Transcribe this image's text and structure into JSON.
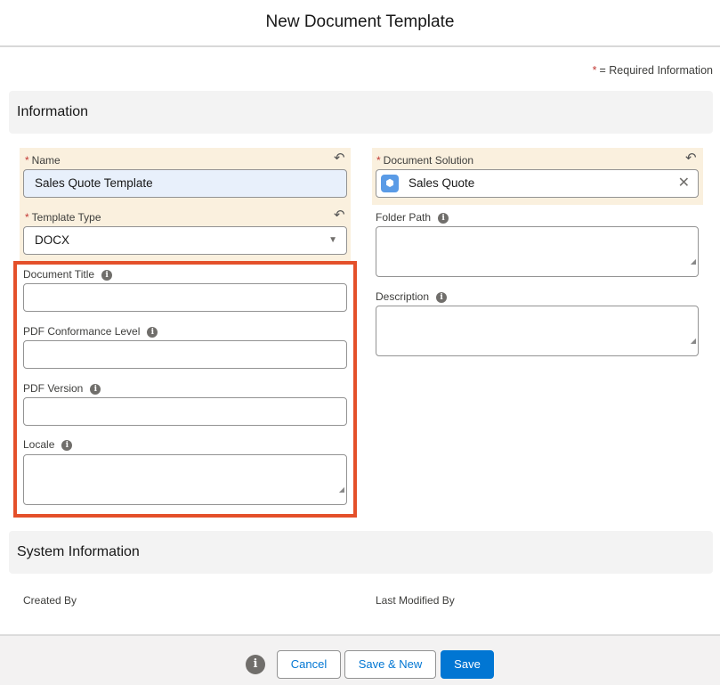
{
  "header": {
    "title": "New Document Template"
  },
  "required_note": {
    "star": "*",
    "text": "= Required Information"
  },
  "sections": {
    "information": "Information",
    "system": "System Information"
  },
  "fields": {
    "name": {
      "label": "Name",
      "value": "Sales Quote Template"
    },
    "template_type": {
      "label": "Template Type",
      "value": "DOCX"
    },
    "document_title": {
      "label": "Document Title",
      "value": ""
    },
    "pdf_conformance": {
      "label": "PDF Conformance Level",
      "value": ""
    },
    "pdf_version": {
      "label": "PDF Version",
      "value": ""
    },
    "locale": {
      "label": "Locale",
      "value": ""
    },
    "document_solution": {
      "label": "Document Solution",
      "value": "Sales Quote"
    },
    "folder_path": {
      "label": "Folder Path",
      "value": ""
    },
    "description": {
      "label": "Description",
      "value": ""
    }
  },
  "system": {
    "created_by": "Created By",
    "last_modified_by": "Last Modified By"
  },
  "footer": {
    "cancel": "Cancel",
    "save_new": "Save & New",
    "save": "Save"
  },
  "colors": {
    "highlight_box": "#e4502a",
    "brand": "#0176d3",
    "changed_field": "#faf0de"
  }
}
